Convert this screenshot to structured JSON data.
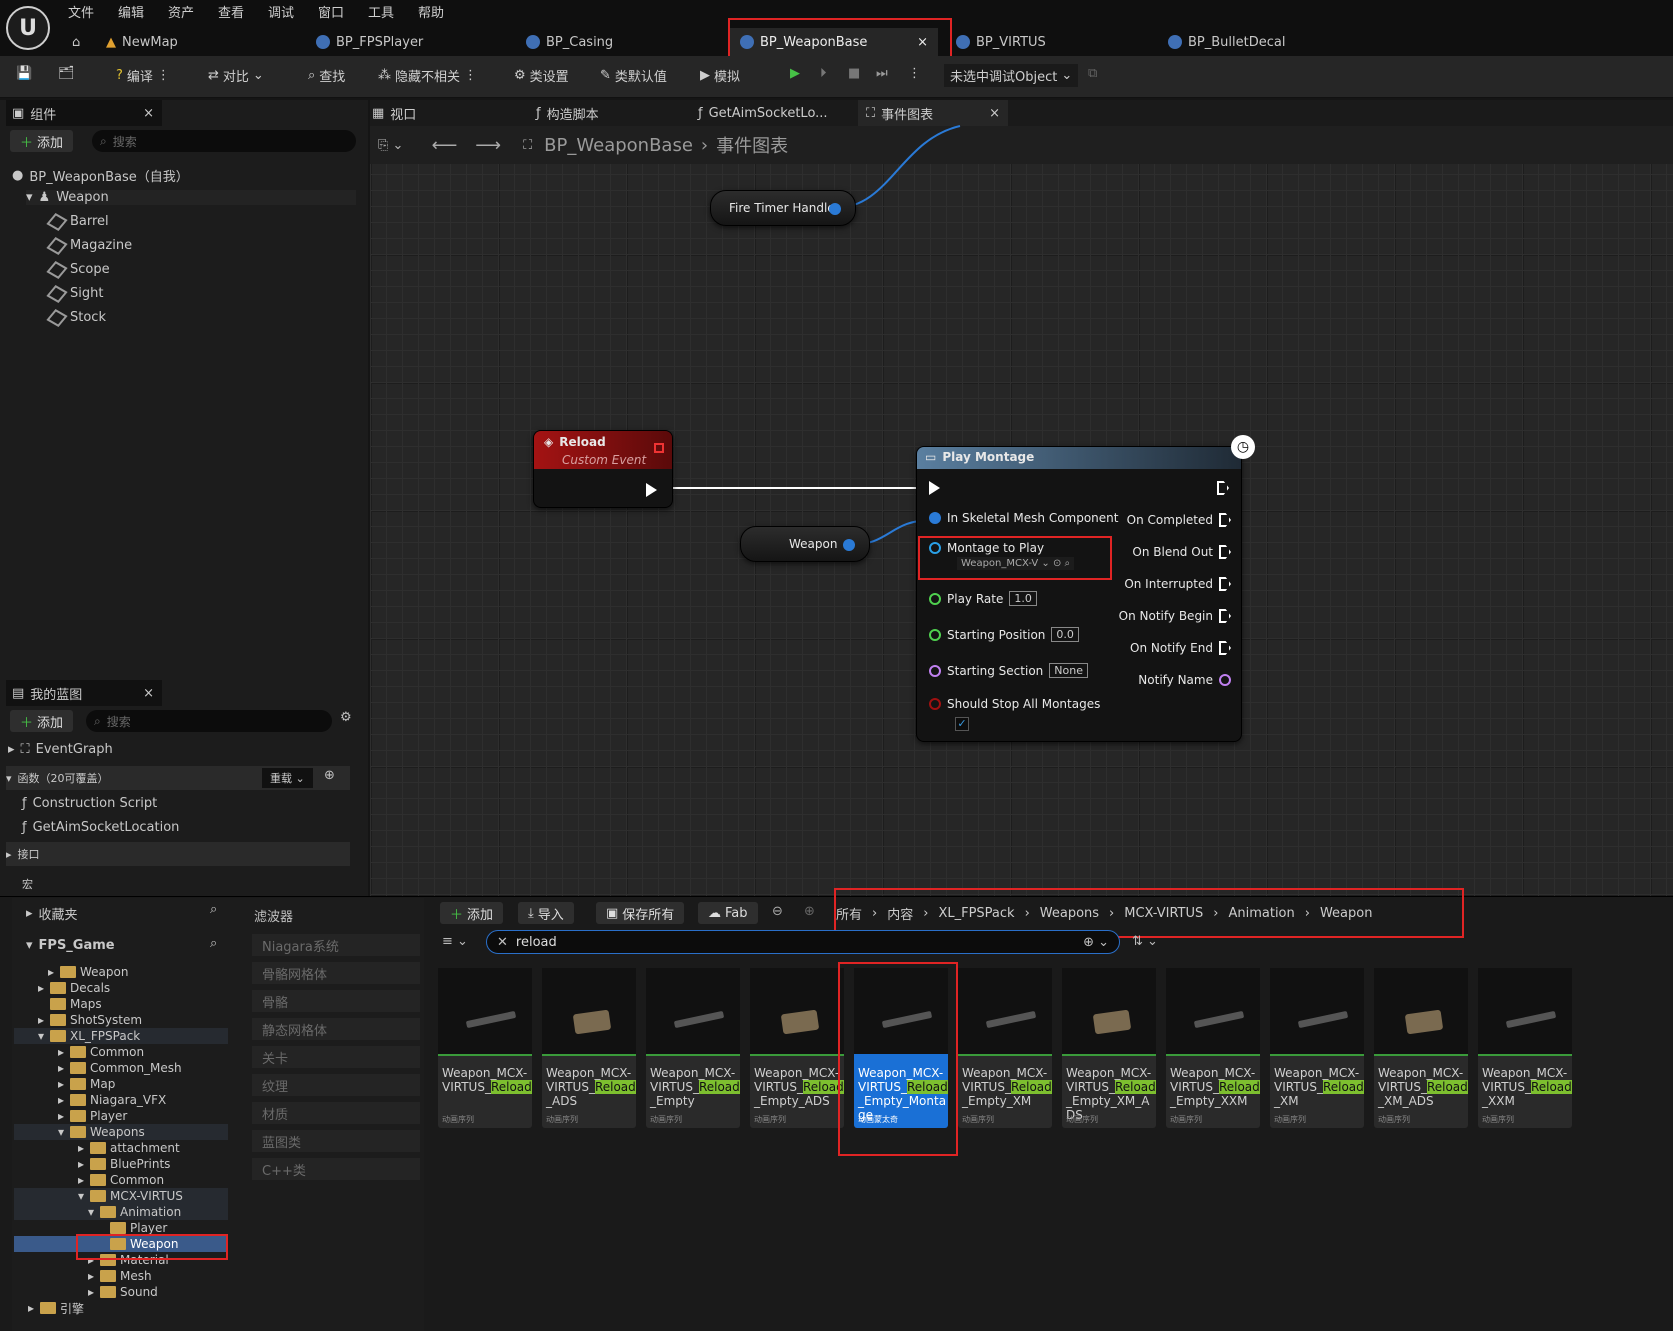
{
  "menu": [
    "文件",
    "编辑",
    "资产",
    "查看",
    "调试",
    "窗口",
    "工具",
    "帮助"
  ],
  "doc_tabs": {
    "home": "NewMap",
    "t1": "BP_FPSPlayer",
    "t2": "BP_Casing",
    "t3": "BP_WeaponBase",
    "t4": "BP_VIRTUS",
    "t5": "BP_BulletDecal"
  },
  "toolbar": {
    "compile": "编译",
    "diff": "对比",
    "find": "查找",
    "hide": "隐藏不相关",
    "class_settings": "类设置",
    "class_defaults": "类默认值",
    "simulate": "模拟",
    "debug_object": "未选中调试Object"
  },
  "components": {
    "title": "组件",
    "add": "添加",
    "search_placeholder": "搜索",
    "root": "BP_WeaponBase（自我）",
    "weapon": "Weapon",
    "children": [
      "Barrel",
      "Magazine",
      "Scope",
      "Sight",
      "Stock"
    ]
  },
  "graph_tabs": {
    "viewport": "视口",
    "construction": "构造脚本",
    "getaim": "GetAimSocketLo...",
    "event_graph": "事件图表"
  },
  "breadcrumb": {
    "bp": "BP_WeaponBase",
    "graph": "事件图表"
  },
  "nodes": {
    "fire_timer": "Fire Timer Handle",
    "reload_title": "Reload",
    "reload_sub": "Custom Event",
    "weapon_var": "Weapon",
    "play_montage": "Play Montage",
    "in_skel": "In Skeletal Mesh Component",
    "montage": "Montage to Play",
    "montage_val": "Weapon_MCX-V",
    "play_rate": "Play Rate",
    "play_rate_val": "1.0",
    "start_pos": "Starting Position",
    "start_pos_val": "0.0",
    "start_sec": "Starting Section",
    "start_sec_val": "None",
    "should_stop": "Should Stop All Montages",
    "on_completed": "On Completed",
    "on_blend_out": "On Blend Out",
    "on_interrupted": "On Interrupted",
    "on_notify_begin": "On Notify Begin",
    "on_notify_end": "On Notify End",
    "notify_name": "Notify Name"
  },
  "my_blueprint": {
    "title": "我的蓝图",
    "add": "添加",
    "search_placeholder": "搜索",
    "event_graph": "EventGraph",
    "functions": "函数（20可覆盖）",
    "override": "重载",
    "construction": "Construction Script",
    "getaim": "GetAimSocketLocation",
    "interfaces": "接口",
    "macros": "宏"
  },
  "content_browser": {
    "favorites": "收藏夹",
    "project": "FPS_Game",
    "filters": "滤波器",
    "add": "添加",
    "import": "导入",
    "save_all": "保存所有",
    "fab": "Fab",
    "path": [
      "所有",
      "内容",
      "XL_FPSPack",
      "Weapons",
      "MCX-VIRTUS",
      "Animation",
      "Weapon"
    ],
    "search_value": "reload",
    "filter_items": [
      "Niagara系统",
      "骨骼网格体",
      "骨骼",
      "静态网格体",
      "关卡",
      "纹理",
      "材质",
      "蓝图类",
      "C++类"
    ],
    "tree": [
      "Weapon",
      "Decals",
      "Maps",
      "ShotSystem",
      "XL_FPSPack",
      "Common",
      "Common_Mesh",
      "Map",
      "Niagara_VFX",
      "Player",
      "Weapons",
      "attachment",
      "BluePrints",
      "Common",
      "MCX-VIRTUS",
      "Animation",
      "Player",
      "Weapon",
      "Material",
      "Mesh",
      "Sound",
      "引擎"
    ],
    "assets": [
      {
        "pre": "Weapon_MCX-VIRTUS_",
        "hl": "Reload",
        "post": "",
        "type": "动画序列"
      },
      {
        "pre": "Weapon_MCX-VIRTUS_",
        "hl": "Reload",
        "post": "_ADS",
        "type": "动画序列"
      },
      {
        "pre": "Weapon_MCX-VIRTUS_",
        "hl": "Reload",
        "post": "_Empty",
        "type": "动画序列"
      },
      {
        "pre": "Weapon_MCX-VIRTUS_",
        "hl": "Reload",
        "post": "_Empty_ADS",
        "type": "动画序列"
      },
      {
        "pre": "Weapon_MCX-VIRTUS_",
        "hl": "Reload",
        "post": "_Empty_Montage",
        "type": "动画蒙太奇"
      },
      {
        "pre": "Weapon_MCX-VIRTUS_",
        "hl": "Reload",
        "post": "_Empty_XM",
        "type": "动画序列"
      },
      {
        "pre": "Weapon_MCX-VIRTUS_",
        "hl": "Reload",
        "post": "_Empty_XM_ADS",
        "type": "动画序列"
      },
      {
        "pre": "Weapon_MCX-VIRTUS_",
        "hl": "Reload",
        "post": "_Empty_XXM",
        "type": "动画序列"
      },
      {
        "pre": "Weapon_MCX-VIRTUS_",
        "hl": "Reload",
        "post": "_XM",
        "type": "动画序列"
      },
      {
        "pre": "Weapon_MCX-VIRTUS_",
        "hl": "Reload",
        "post": "_XM_ADS",
        "type": "动画序列"
      },
      {
        "pre": "Weapon_MCX-VIRTUS_",
        "hl": "Reload",
        "post": "_XXM",
        "type": "动画序列"
      }
    ]
  }
}
